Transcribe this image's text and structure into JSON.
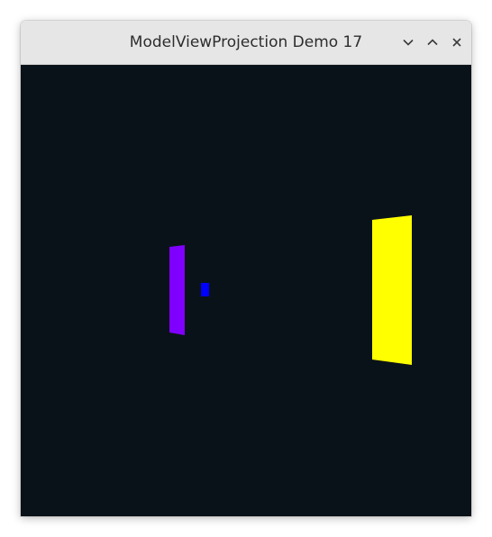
{
  "window": {
    "title": "ModelViewProjection Demo 17"
  },
  "controls": {
    "minimize_icon": "chevron-down-icon",
    "maximize_icon": "chevron-up-icon",
    "close_icon": "close-icon"
  },
  "scene": {
    "background_color": "#0a1219",
    "objects": [
      {
        "name": "purple-panel",
        "color": "#8000ff"
      },
      {
        "name": "blue-square",
        "color": "#0000ff"
      },
      {
        "name": "yellow-panel",
        "color": "#ffff00"
      }
    ]
  }
}
